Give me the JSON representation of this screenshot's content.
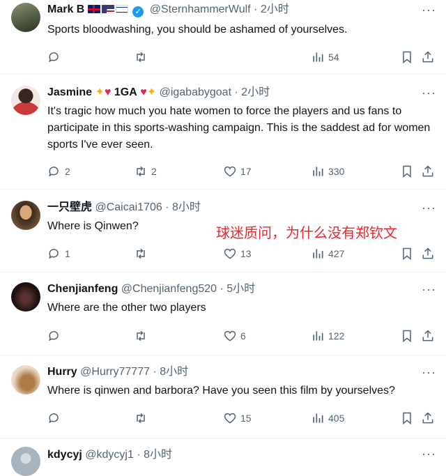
{
  "tweets": [
    {
      "name": "Mark B",
      "handle": "@SternhammerWulf",
      "time": "· 2小时",
      "text": "Sports bloodwashing, you should be  ashamed of yourselves.",
      "replies": "",
      "retweets": "",
      "likes": "",
      "views": "54",
      "avatar_color": "#6b7a5c"
    },
    {
      "name": "Jasmine",
      "name_badge": "1GA",
      "handle": "@igababygoat",
      "time": "· 2小时",
      "text": "It's tragic how much you hate women to force the players and us fans to participate in this sports-washing campaign. This is the saddest ad for women sports I've ever seen.",
      "replies": "2",
      "retweets": "2",
      "likes": "17",
      "views": "330",
      "avatar_color": "#c93a3a"
    },
    {
      "name": "一只壁虎",
      "handle": "@Caicai1706",
      "time": "· 8小时",
      "text": "Where is Qinwen?",
      "replies": "1",
      "retweets": "",
      "likes": "13",
      "views": "427",
      "avatar_color": "#7a5a3a"
    },
    {
      "name": "Chenjianfeng",
      "handle": "@Chenjianfeng520",
      "time": "· 5小时",
      "text": "Where are the other two players",
      "replies": "",
      "retweets": "",
      "likes": "6",
      "views": "122",
      "avatar_color": "#1c1010"
    },
    {
      "name": "Hurry",
      "handle": "@Hurry77777",
      "time": "· 8小时",
      "text": "Where is qinwen and barbora?  Have you seen this film by yourselves?",
      "replies": "",
      "retweets": "",
      "likes": "15",
      "views": "405",
      "avatar_color": "#c8a070"
    },
    {
      "name": "kdycyj",
      "handle": "@kdycyj1",
      "time": "· 8小时",
      "avatar_color": "#a7b3bd"
    }
  ],
  "annotation": "球迷质问，为什么没有郑钦文",
  "colors": {
    "text": "#0f1419",
    "muted": "#536471",
    "annotation": "#e8262c",
    "verified": "#1d9bf0"
  }
}
